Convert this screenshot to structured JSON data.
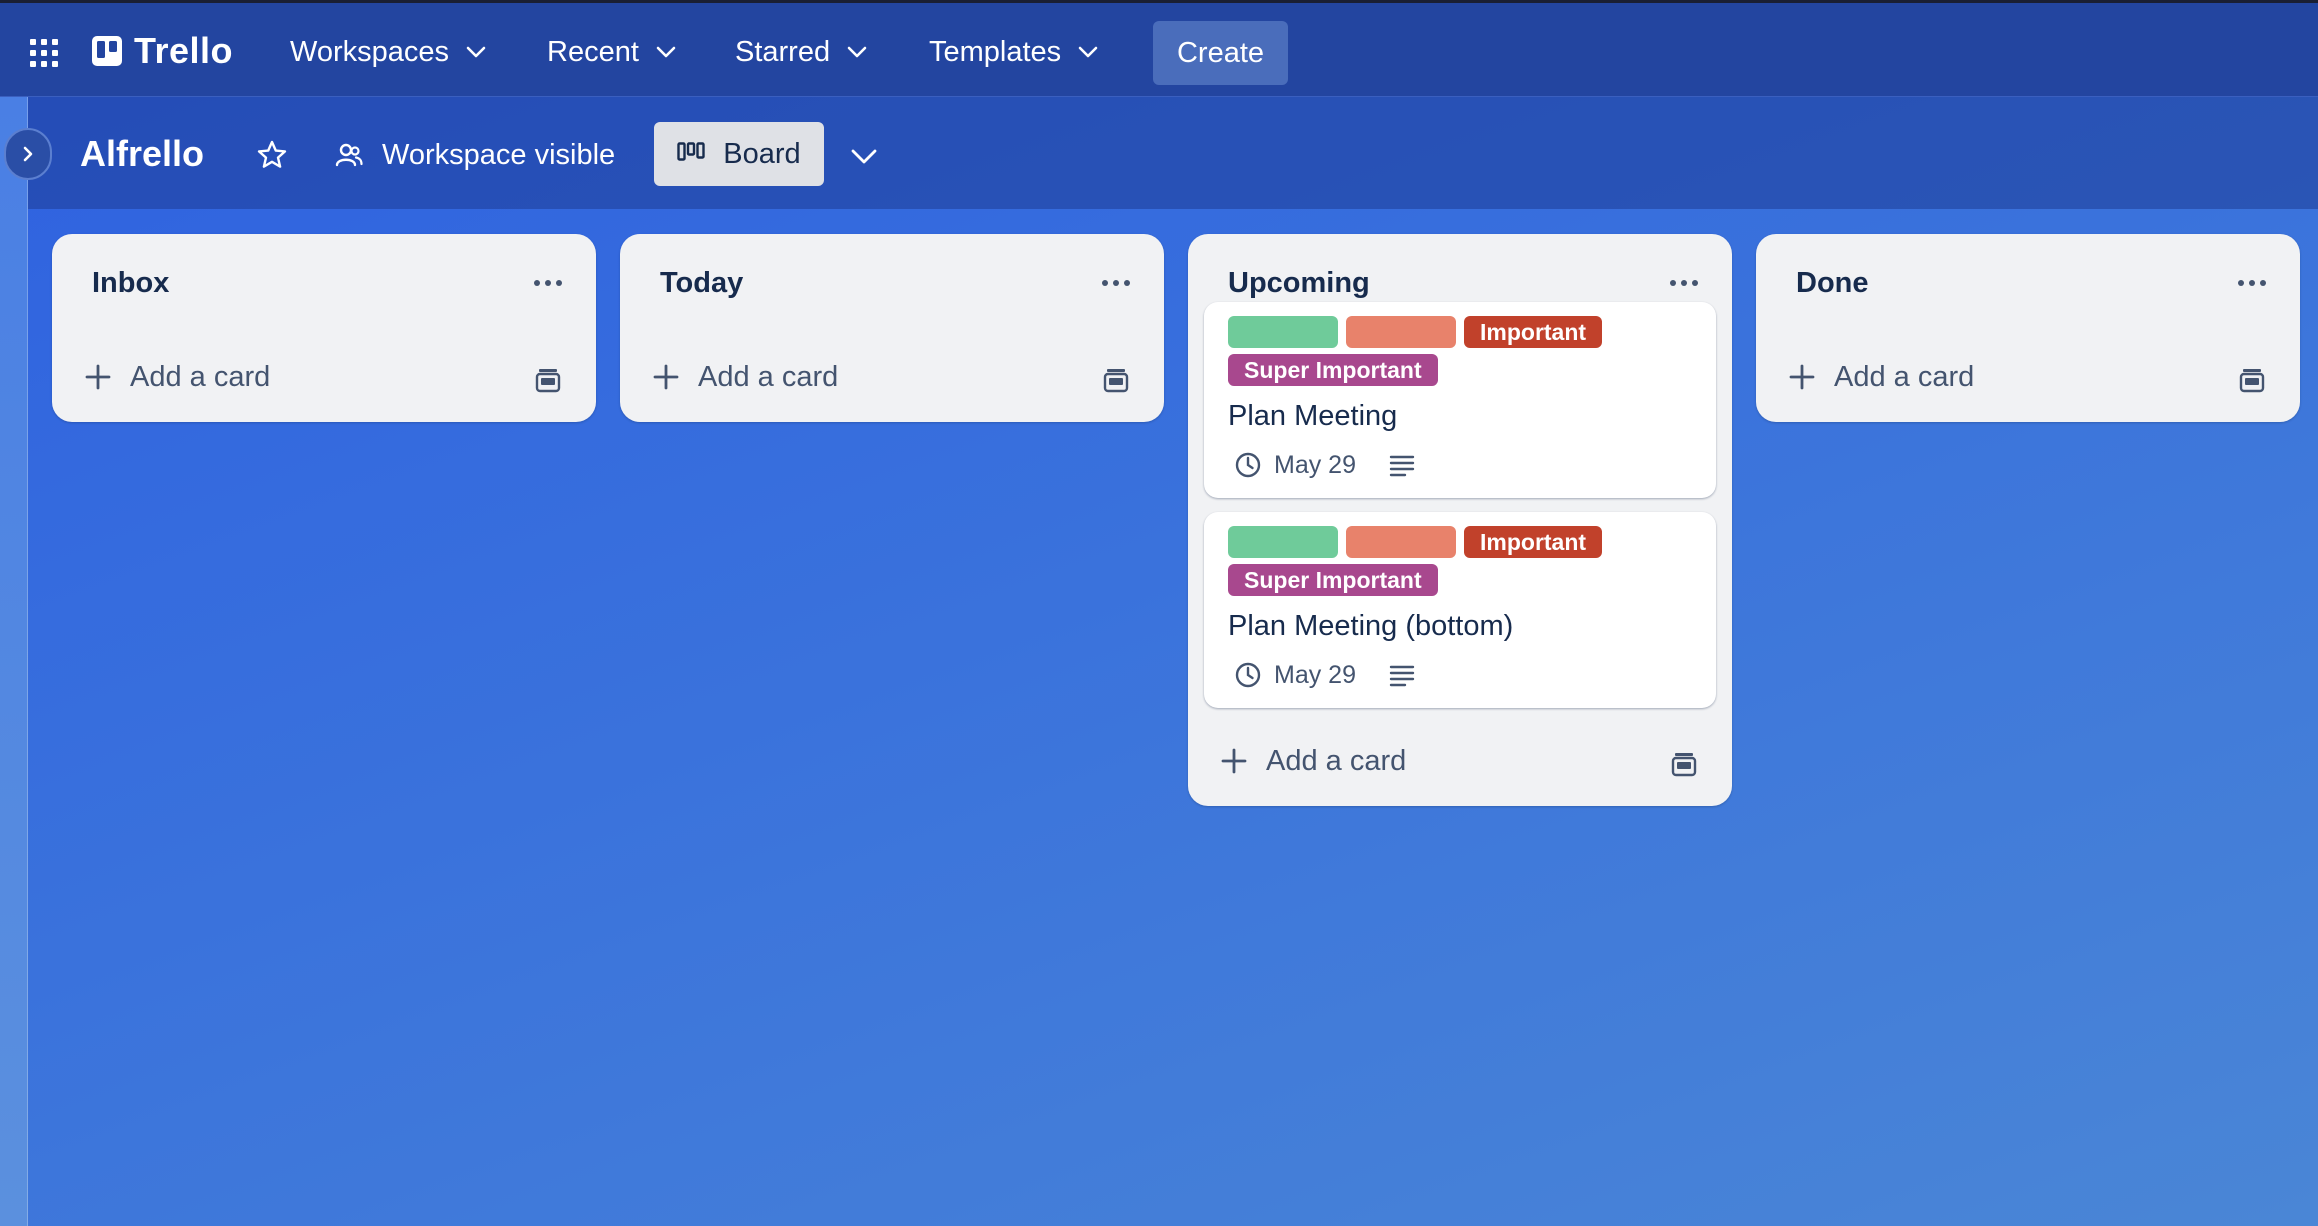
{
  "header": {
    "app_name": "Trello",
    "nav": [
      {
        "label": "Workspaces"
      },
      {
        "label": "Recent"
      },
      {
        "label": "Starred"
      },
      {
        "label": "Templates"
      }
    ],
    "create_label": "Create"
  },
  "board": {
    "title": "Alfrello",
    "visibility_label": "Workspace visible",
    "view_label": "Board"
  },
  "lists": [
    {
      "title": "Inbox",
      "add_label": "Add a card",
      "cards": []
    },
    {
      "title": "Today",
      "add_label": "Add a card",
      "cards": []
    },
    {
      "title": "Upcoming",
      "add_label": "Add a card",
      "cards": [
        {
          "title": "Plan Meeting",
          "labels": [
            {
              "text": "",
              "color": "#6fcb9a"
            },
            {
              "text": "",
              "color": "#e8826b"
            },
            {
              "text": "Important",
              "color": "#c1412b"
            },
            {
              "text": "Super Important",
              "color": "#a8488e"
            }
          ],
          "due": "May 29"
        },
        {
          "title": "Plan Meeting (bottom)",
          "labels": [
            {
              "text": "",
              "color": "#6fcb9a"
            },
            {
              "text": "",
              "color": "#e8826b"
            },
            {
              "text": "Important",
              "color": "#c1412b"
            },
            {
              "text": "Super Important",
              "color": "#a8488e"
            }
          ],
          "due": "May 29"
        }
      ]
    },
    {
      "title": "Done",
      "add_label": "Add a card",
      "cards": []
    }
  ],
  "colors": {
    "header_bg": "#2345a0",
    "list_bg": "#f1f2f4",
    "text_primary": "#172b4d",
    "text_subtle": "#44546f"
  }
}
